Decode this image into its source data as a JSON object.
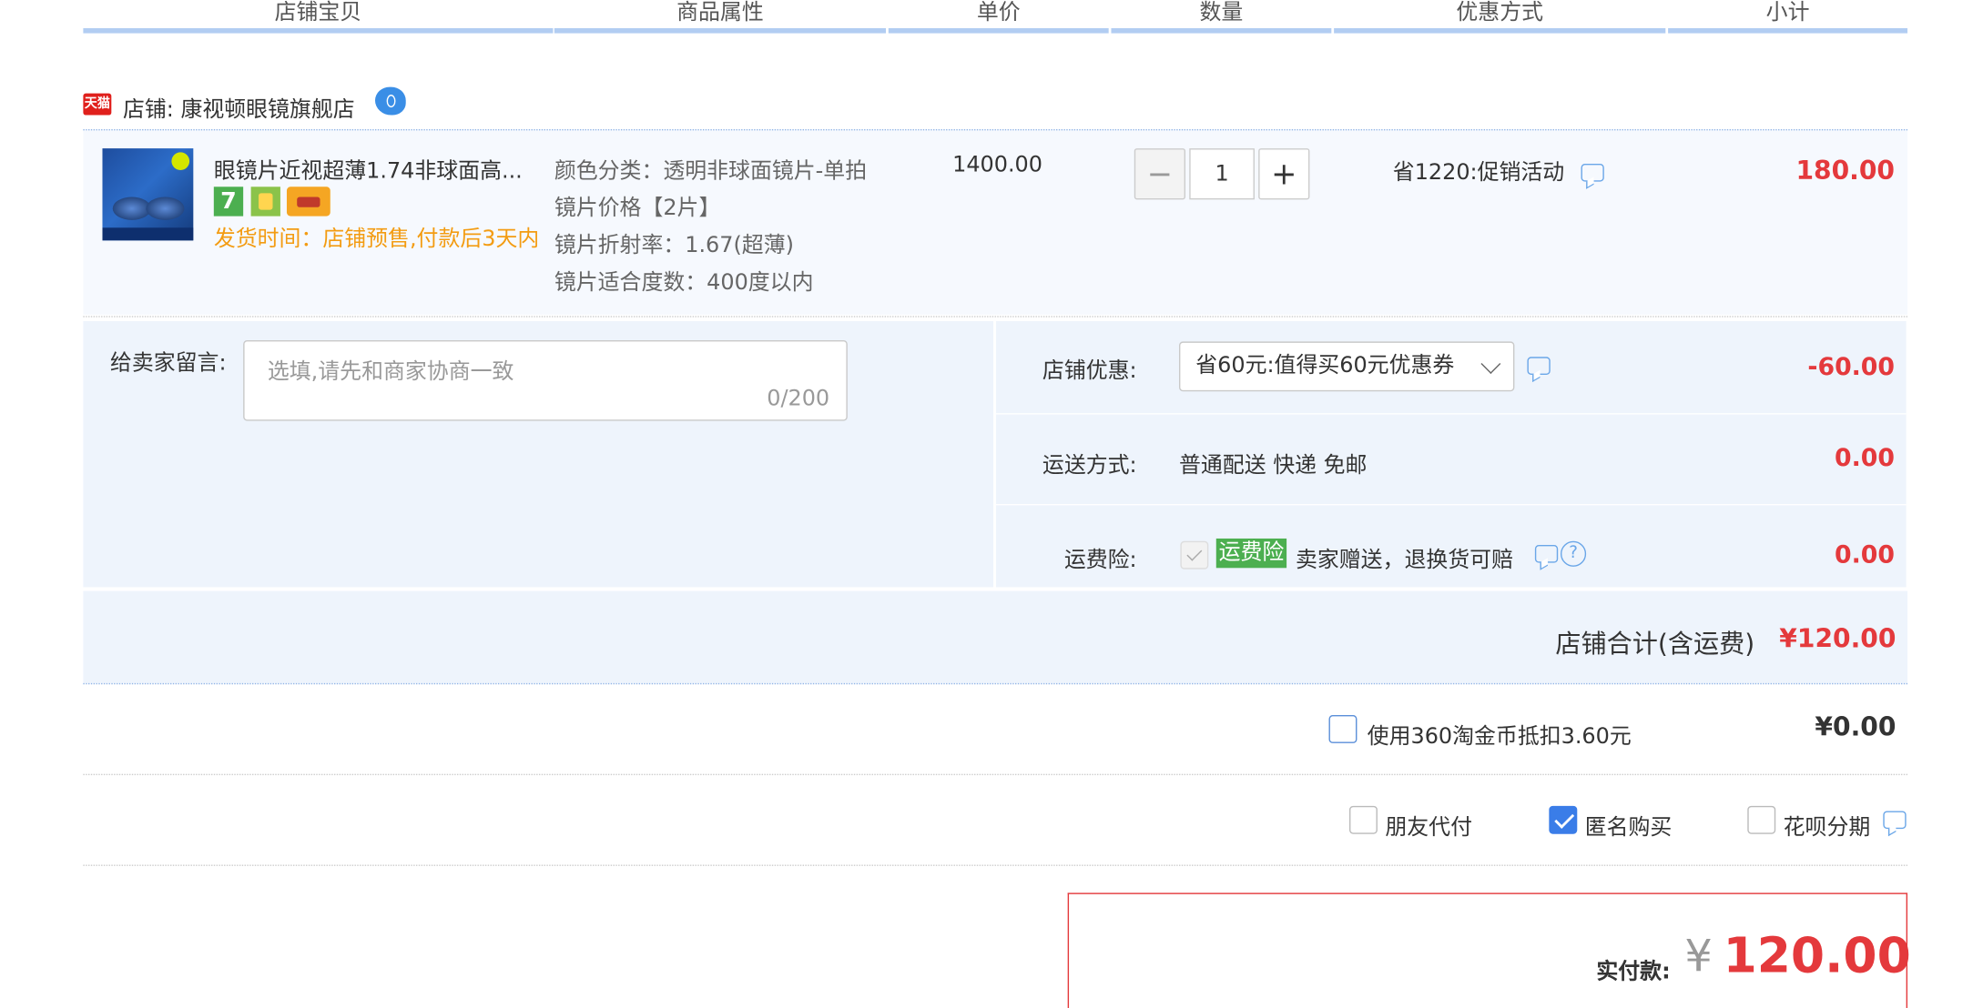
{
  "header": {
    "columns": [
      "店铺宝贝",
      "商品属性",
      "单价",
      "数量",
      "优惠方式",
      "小计"
    ]
  },
  "shop": {
    "badge": "天猫",
    "label": "店铺: 康视顿眼镜旗舰店",
    "wangwang_icon": "wangwang-chat-icon"
  },
  "item": {
    "title": "眼镜片近视超薄1.74非球面高...",
    "service_badge_7": "7",
    "ship_time": "发货时间：店铺预售,付款后3天内",
    "attributes": [
      "颜色分类：透明非球面镜片-单拍",
      "镜片价格【2片】",
      "镜片折射率：1.67(超薄)",
      "镜片适合度数：400度以内"
    ],
    "unit_price": "1400.00",
    "quantity": "1",
    "minus": "−",
    "plus": "+",
    "promotion": "省1220:促销活动",
    "subtotal": "180.00"
  },
  "message": {
    "label": "给卖家留言:",
    "placeholder": "选填,请先和商家协商一致",
    "counter": "0/200"
  },
  "discount": {
    "label": "店铺优惠:",
    "selected": "省60元:值得买60元优惠券",
    "value": "-60.00"
  },
  "shipping": {
    "label": "运送方式:",
    "text": "普通配送 快递 免邮",
    "value": "0.00"
  },
  "insurance": {
    "label": "运费险:",
    "badge": "运费险",
    "text": "卖家赠送，退换货可赔",
    "help": "?",
    "value": "0.00"
  },
  "shop_total": {
    "label": "店铺合计(含运费)",
    "value": "¥120.00"
  },
  "coins": {
    "label": "使用360淘金币抵扣3.60元",
    "value": "¥0.00",
    "checked": false
  },
  "options": {
    "friend_pay": {
      "label": "朋友代付",
      "checked": false
    },
    "anonymous": {
      "label": "匿名购买",
      "checked": true
    },
    "huabei": {
      "label": "花呗分期",
      "checked": false
    }
  },
  "payment": {
    "label": "实付款:",
    "currency": "¥",
    "value": "120.00"
  },
  "colors": {
    "accent_red": "#e4393c",
    "accent_blue": "#3a7de8",
    "header_bar": "#b2cdf2",
    "panel_bg": "#eef4fc"
  }
}
